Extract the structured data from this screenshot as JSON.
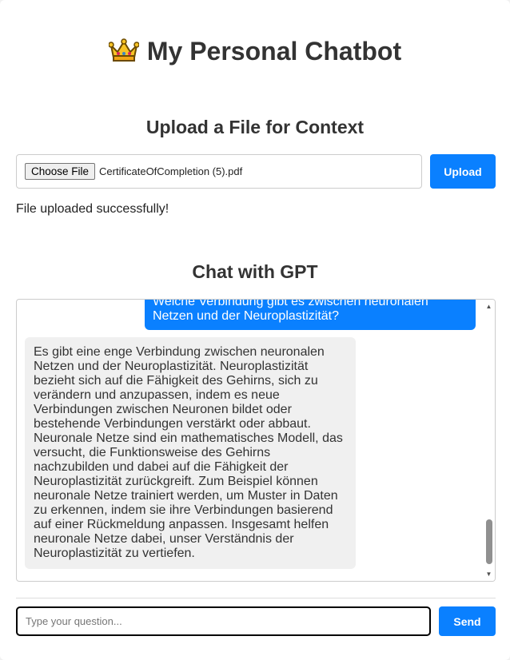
{
  "header": {
    "title": "My Personal Chatbot",
    "icon": "crown-icon"
  },
  "upload": {
    "heading": "Upload a File for Context",
    "choose_label": "Choose File",
    "file_name": "CertificateOfCompletion (5).pdf",
    "button_label": "Upload",
    "status": "File uploaded successfully!"
  },
  "chat": {
    "heading": "Chat with GPT",
    "messages": [
      {
        "role": "user",
        "text": "Welche Verbindung gibt es zwischen neuronalen Netzen und der Neuroplastizität?"
      },
      {
        "role": "bot",
        "text": "Es gibt eine enge Verbindung zwischen neuronalen Netzen und der Neuroplastizität. Neuroplastizität bezieht sich auf die Fähigkeit des Gehirns, sich zu verändern und anzupassen, indem es neue Verbindungen zwischen Neuronen bildet oder bestehende Verbindungen verstärkt oder abbaut. Neuronale Netze sind ein mathematisches Modell, das versucht, die Funktionsweise des Gehirns nachzubilden und dabei auf die Fähigkeit der Neuroplastizität zurückgreift. Zum Beispiel können neuronale Netze trainiert werden, um Muster in Daten zu erkennen, indem sie ihre Verbindungen basierend auf einer Rückmeldung anpassen. Insgesamt helfen neuronale Netze dabei, unser Verständnis der Neuroplastizität zu vertiefen."
      }
    ],
    "input_value": "",
    "input_placeholder": "Type your question...",
    "send_label": "Send"
  },
  "colors": {
    "accent": "#0a80ff",
    "bot_bubble": "#f0f0f0",
    "text": "#333333"
  }
}
